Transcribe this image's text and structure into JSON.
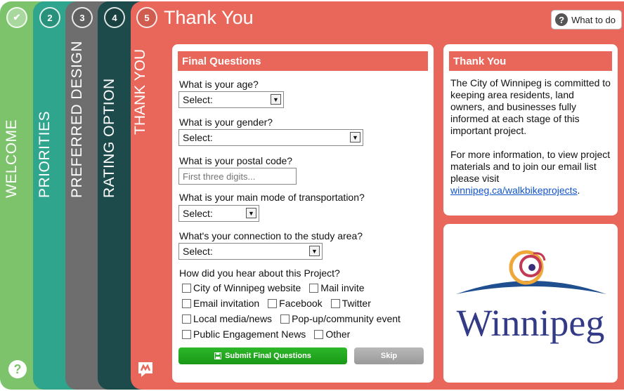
{
  "tabs": [
    {
      "number": "✔",
      "label": "WELCOME"
    },
    {
      "number": "2",
      "label": "PRIORITIES"
    },
    {
      "number": "3",
      "label": "PREFERRED DESIGN"
    },
    {
      "number": "4",
      "label": "RATING OPTION"
    },
    {
      "number": "5",
      "label": "THANK YOU"
    }
  ],
  "help_button": "?",
  "header": {
    "title": "Thank You",
    "what_to_do_label": "What to do",
    "help_glyph": "?"
  },
  "form": {
    "heading": "Final Questions",
    "age": {
      "label": "What is your age?",
      "value": "Select:"
    },
    "gender": {
      "label": "What is your gender?",
      "value": "Select:"
    },
    "postal": {
      "label": "What is your postal code?",
      "placeholder": "First three digits..."
    },
    "transport": {
      "label": "What is your main mode of transportation?",
      "value": "Select:"
    },
    "connection": {
      "label": "What's your connection to the study area?",
      "value": "Select:"
    },
    "hear": {
      "label": "How did you hear about this Project?",
      "options": [
        "City of Winnipeg website",
        "Mail invite",
        "Email invitation",
        "Facebook",
        "Twitter",
        "Local media/news",
        "Pop-up/community event",
        "Public Engagement News",
        "Other"
      ]
    },
    "submit_label": "Submit Final Questions",
    "skip_label": "Skip"
  },
  "thanks": {
    "heading": "Thank You",
    "paragraph1": "The City of Winnipeg is committed to keeping area residents, land owners, and businesses fully informed at each stage of this important project.",
    "paragraph2": "For more information, to view project materials and to join our email list please visit",
    "link": "winnipeg.ca/walkbikeprojects",
    "link_suffix": "."
  },
  "logo": {
    "wordmark": "Winnipeg"
  },
  "colors": {
    "welcome": "#7cc36b",
    "priorities": "#2ea58c",
    "design": "#6e6e6e",
    "rating": "#1d4a4b",
    "thanks": "#e8675a",
    "submit": "#1a9816",
    "link": "#1155cc"
  },
  "icons": {
    "tab1_done": "check-icon",
    "help": "question-icon",
    "submit": "save-icon",
    "brand": "chat-logo-icon",
    "dropdown": "chevron-down-icon"
  }
}
